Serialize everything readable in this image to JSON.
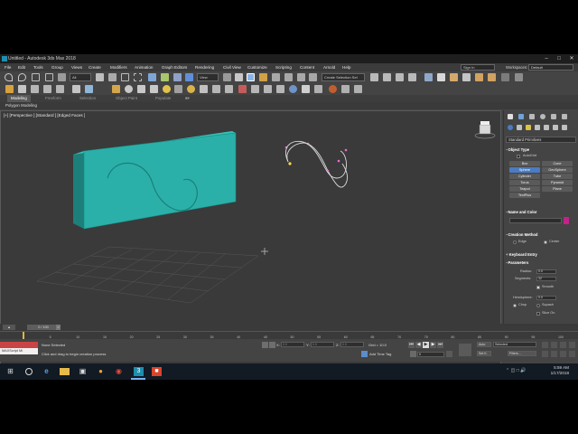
{
  "window": {
    "title": "Untitled - Autodesk 3ds Max 2018"
  },
  "menu": {
    "items": [
      "File",
      "Edit",
      "Tools",
      "Group",
      "Views",
      "Create",
      "Modifiers",
      "Animation",
      "Graph Editors",
      "Rendering",
      "Civil View",
      "Customize",
      "Scripting",
      "Content",
      "Arnold",
      "Help"
    ],
    "sign_in": "Sign In",
    "workspaces_label": "Workspaces:",
    "workspaces_value": "Default"
  },
  "toolbar": {
    "filter": "All",
    "refcoord": "View",
    "selection_set": "Create Selection Set"
  },
  "ribbon": {
    "tabs": [
      "Modeling",
      "Freeform",
      "Selection",
      "Object Paint",
      "Populate"
    ],
    "active_tab": "Modeling",
    "sub_label": "Polygon Modeling"
  },
  "viewport": {
    "label": "[+] [Perspective ] [Standard ] [Edged Faces ]",
    "colors": {
      "box": "#2ab0a8",
      "box_side": "#1d7f7a",
      "spline": "#dcdcdc",
      "vertex": "#f06bd6",
      "grid": "#555555"
    }
  },
  "command_panel": {
    "dropdown": "Standard Primitives",
    "object_type": {
      "header": "Object Type",
      "autogrid": "AutoGrid",
      "buttons": [
        "Box",
        "Cone",
        "Sphere",
        "GeoSphere",
        "Cylinder",
        "Tube",
        "Torus",
        "Pyramid",
        "Teapot",
        "Plane",
        "TextPlus"
      ],
      "selected": "Sphere"
    },
    "name_color": {
      "header": "Name and Color",
      "swatch": "#c3228a"
    },
    "creation_method": {
      "header": "Creation Method",
      "options": [
        "Edge",
        "Center"
      ],
      "selected": "Center"
    },
    "keyboard_entry": {
      "header": "Keyboard Entry"
    },
    "parameters": {
      "header": "Parameters",
      "radius_label": "Radius:",
      "radius_value": "0.0",
      "segments_label": "Segments:",
      "segments_value": "32",
      "smooth_label": "Smooth",
      "hemisphere_label": "Hemisphere:",
      "hemisphere_value": "0.0",
      "chop_label": "Chop",
      "squash_label": "Squash",
      "slice_on_label": "Slice On"
    }
  },
  "timeline": {
    "slider": "0 / 100",
    "ticks": [
      "0",
      "5",
      "10",
      "15",
      "20",
      "25",
      "30",
      "35",
      "40",
      "45",
      "50",
      "55",
      "60",
      "65",
      "70",
      "75",
      "80",
      "85",
      "90",
      "95",
      "100"
    ]
  },
  "status": {
    "maxscript": "MAXScript Mi",
    "selection": "None Selected",
    "prompt": "Click and drag to begin creation process",
    "x_label": "X:",
    "y_label": "Y:",
    "z_label": "Z:",
    "x_value": "0.0",
    "y_value": "0.0",
    "z_value": "0.0",
    "grid": "Grid = 10.0",
    "add_time_tag": "Add Time Tag",
    "auto_key": "Auto",
    "selected_dd": "Selected",
    "set_key": "Set K.",
    "filters": "Filters...",
    "frame_value": "0"
  },
  "taskbar": {
    "time": "5:59 AM",
    "date": "1/17/2018"
  }
}
